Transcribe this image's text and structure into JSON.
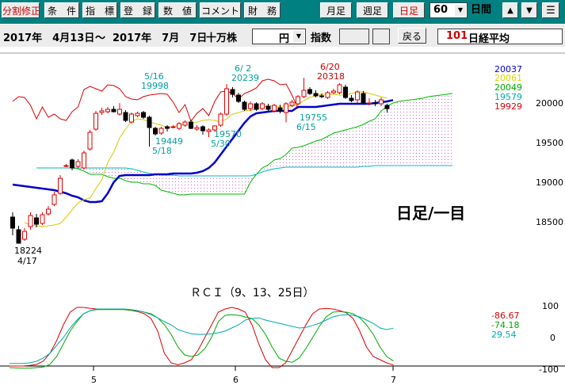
{
  "toolbar": {
    "buttons": [
      "分割修正",
      "条　件",
      "指　標",
      "登　録",
      "数　値",
      "コメント",
      "財　務"
    ],
    "period_buttons": [
      "月足",
      "週足",
      "日足"
    ],
    "count_value": "60",
    "count_unit": "日間",
    "nav_icons": [
      "up-arrow-icon",
      "down-arrow-icon",
      "menu-icon"
    ],
    "accent_color": "#008080"
  },
  "range_bar": {
    "start_date": "2017年　4月13日",
    "tilde": "～",
    "end_date": "2017年　7月　7日",
    "unit_label": "十万株",
    "currency_value": "円",
    "index_label": "指数",
    "back_button": "戻る",
    "code": "101",
    "name": "日経平均"
  },
  "chart_data": [
    {
      "type": "candlestick",
      "label": "日足/一目",
      "y_ticks": [
        18500,
        19000,
        19500,
        20000
      ],
      "ylim": [
        18200,
        20700
      ],
      "x_ticks": [
        "5",
        "6",
        "7"
      ],
      "legend_values": [
        {
          "value": "20037",
          "color": "#0000cc"
        },
        {
          "value": "20061",
          "color": "#d8d800"
        },
        {
          "value": "20049",
          "color": "#00aa00"
        },
        {
          "value": "19579",
          "color": "#00aaaa"
        },
        {
          "value": "19929",
          "color": "#dd0000"
        }
      ],
      "annotations": [
        {
          "text": "18224",
          "date": "4/17",
          "color": "#000000"
        },
        {
          "text": "19998",
          "date": "5/16",
          "color": "#00a0a0"
        },
        {
          "text": "19449",
          "date": "5/18",
          "color": "#00a0a0"
        },
        {
          "text": "19570",
          "date": "5/30",
          "color": "#00a0a0"
        },
        {
          "text": "20239",
          "date": "6/ 2",
          "color": "#00a0a0"
        },
        {
          "text": "19755",
          "date": "6/15",
          "color": "#00a0a0"
        },
        {
          "text": "20318",
          "date": "6/20",
          "color": "#cc0000"
        }
      ],
      "candles": [
        [
          18560,
          18420,
          18620,
          18330
        ],
        [
          18400,
          18230,
          18450,
          18224
        ],
        [
          18280,
          18380,
          18420,
          18260
        ],
        [
          18440,
          18580,
          18620,
          18400
        ],
        [
          18550,
          18470,
          18600,
          18430
        ],
        [
          18480,
          18590,
          18620,
          18460
        ],
        [
          18600,
          18660,
          18700,
          18580
        ],
        [
          18720,
          18840,
          18880,
          18700
        ],
        [
          18860,
          19050,
          19090,
          18840
        ],
        [
          19210,
          19210,
          19230,
          19190
        ],
        [
          19280,
          19180,
          19300,
          19150
        ],
        [
          19200,
          19260,
          19290,
          19180
        ],
        [
          19180,
          19370,
          19400,
          19160
        ],
        [
          19420,
          19630,
          19660,
          19400
        ],
        [
          19670,
          19870,
          19900,
          19650
        ],
        [
          19880,
          19900,
          19940,
          19850
        ],
        [
          19890,
          19920,
          19950,
          19870
        ],
        [
          19920,
          19890,
          19960,
          19880
        ],
        [
          19860,
          19920,
          19998,
          19840
        ],
        [
          19880,
          19780,
          19910,
          19760
        ],
        [
          19760,
          19860,
          19880,
          19740
        ],
        [
          19840,
          19870,
          19890,
          19820
        ],
        [
          19880,
          19820,
          19900,
          19800
        ],
        [
          19820,
          19690,
          19840,
          19449
        ],
        [
          19680,
          19610,
          19700,
          19590
        ],
        [
          19620,
          19680,
          19700,
          19600
        ],
        [
          19700,
          19680,
          19720,
          19640
        ],
        [
          19690,
          19700,
          19720,
          19680
        ],
        [
          19680,
          19740,
          19760,
          19660
        ],
        [
          19720,
          19760,
          19780,
          19700
        ],
        [
          19760,
          19680,
          19790,
          19670
        ],
        [
          19670,
          19690,
          19720,
          19650
        ],
        [
          19700,
          19650,
          19720,
          19600
        ],
        [
          19640,
          19660,
          19680,
          19570
        ],
        [
          19660,
          19710,
          19720,
          19640
        ],
        [
          19720,
          19860,
          19880,
          19700
        ],
        [
          19860,
          20180,
          20239,
          19840
        ],
        [
          20170,
          20110,
          20200,
          20070
        ],
        [
          20100,
          20020,
          20130,
          20000
        ],
        [
          20010,
          19920,
          20030,
          19900
        ],
        [
          19930,
          19990,
          20020,
          19900
        ],
        [
          19990,
          19920,
          20010,
          19900
        ],
        [
          19930,
          19990,
          20010,
          19910
        ],
        [
          19960,
          19920,
          19990,
          19900
        ],
        [
          19900,
          19970,
          19990,
          19880
        ],
        [
          19940,
          19900,
          19980,
          19870
        ],
        [
          19880,
          19990,
          20010,
          19755
        ],
        [
          19970,
          20010,
          20040,
          19950
        ],
        [
          19990,
          20080,
          20100,
          19970
        ],
        [
          20080,
          20160,
          20318,
          20060
        ],
        [
          20170,
          20120,
          20200,
          20100
        ],
        [
          20120,
          20090,
          20160,
          20070
        ],
        [
          20090,
          20080,
          20120,
          20060
        ],
        [
          20070,
          20130,
          20150,
          20050
        ],
        [
          20130,
          20150,
          20180,
          20110
        ],
        [
          20130,
          20230,
          20250,
          20110
        ],
        [
          20200,
          20070,
          20230,
          20050
        ],
        [
          20060,
          20030,
          20100,
          20010
        ],
        [
          20040,
          20140,
          20160,
          20000
        ],
        [
          20120,
          20000,
          20150,
          19980
        ],
        [
          20000,
          20000,
          20060,
          19970
        ],
        [
          20000,
          19990,
          20040,
          19960
        ],
        [
          19990,
          20040,
          20070,
          19960
        ],
        [
          19970,
          19929,
          19990,
          19880
        ]
      ],
      "kijun": [
        18970,
        18960,
        18950,
        18940,
        18930,
        18920,
        18910,
        18900,
        18880,
        18860,
        18830,
        18810,
        18770,
        18750,
        18750,
        18760,
        18860,
        19000,
        19080,
        19090,
        19090,
        19090,
        19090,
        19090,
        19100,
        19100,
        19100,
        19110,
        19110,
        19110,
        19110,
        19120,
        19140,
        19180,
        19250,
        19350,
        19450,
        19550,
        19650,
        19750,
        19830,
        19870,
        19880,
        19890,
        19900,
        19900,
        19900,
        19900,
        19950,
        19950,
        19950,
        19950,
        19960,
        19970,
        19980,
        19990,
        19990,
        19990,
        19990,
        19990,
        19990,
        20000,
        20010,
        20020,
        20037
      ],
      "tenkan": [
        18490,
        18460,
        18450,
        18440,
        18450,
        18460,
        18480,
        18560,
        18650,
        18740,
        18780,
        18800,
        18920,
        19030,
        19250,
        19380,
        19560,
        19670,
        19770,
        19800,
        19790,
        19760,
        19740,
        19720,
        19690,
        19700,
        19720,
        19730,
        19740,
        19760,
        19780,
        19790,
        19780,
        19760,
        19800,
        19860,
        19880,
        19900,
        19910,
        19920,
        19950,
        19960,
        19960,
        19960,
        19960,
        19960,
        19980,
        20030,
        20070,
        20090,
        20110,
        20110,
        20110,
        20100,
        20100,
        20120,
        20140,
        20140,
        20120,
        20100,
        20080,
        20061
      ],
      "chikou": [
        20020,
        20080,
        20070,
        19970,
        19800,
        19950,
        19820,
        19860,
        19800,
        19780,
        19890,
        19950,
        20170,
        20210,
        20180,
        20150,
        20230,
        20220,
        20180,
        20080,
        20050,
        20040,
        20080,
        20100,
        20110,
        20120,
        20110,
        20010,
        19880,
        19980,
        19770,
        19870,
        19930,
        19840,
        20020,
        20140,
        20150,
        20120,
        20050,
        20120,
        20150,
        20190,
        20280,
        20300,
        20280,
        20230,
        20240,
        20100,
        19929
      ],
      "senkou_a_start": 4,
      "senkou_a": [
        19180,
        19180,
        19180,
        19180,
        19180,
        19180,
        19180,
        19170,
        19140,
        19100,
        19100,
        19100,
        19070,
        19050,
        19050,
        19020,
        19000,
        19000,
        18980,
        18980,
        18960,
        18900,
        18880,
        18860,
        18840,
        18840,
        18850,
        18850,
        18850,
        18850,
        18850,
        18850,
        18850,
        18850,
        18850,
        18850,
        19000,
        19100,
        19180,
        19220,
        19280,
        19300,
        19350,
        19430,
        19440,
        19460,
        19490,
        19520,
        19540,
        19580,
        19620,
        19640,
        19660,
        19680,
        19700,
        19730,
        19770,
        19800,
        19900,
        19960,
        20000,
        20020,
        20030,
        20040,
        20050,
        20060,
        20080,
        20090,
        20100,
        20110,
        20120
      ],
      "senkou_b_start": 4,
      "senkou_b": [
        19180,
        19180,
        19180,
        19180,
        19180,
        19180,
        19180,
        19180,
        19180,
        19180,
        19180,
        19180,
        19180,
        19180,
        19180,
        19180,
        19170,
        19150,
        19130,
        19110,
        19100,
        19090,
        19090,
        19090,
        19080,
        19080,
        19080,
        19080,
        19080,
        19080,
        19080,
        19080,
        19080,
        19080,
        19080,
        19080,
        19080,
        19100,
        19130,
        19150,
        19170,
        19180,
        19190,
        19190,
        19190,
        19190,
        19190,
        19190,
        19190,
        19190,
        19190,
        19190,
        19190,
        19190,
        19190,
        19200,
        19200,
        19210,
        19210,
        19210,
        19210,
        19210,
        19210,
        19210,
        19210,
        19210,
        19210,
        19210,
        19210,
        19210,
        19210
      ]
    },
    {
      "type": "line",
      "title": "ＲＣＩ（9、13、25日）",
      "ylim": [
        -100,
        100
      ],
      "y_ticks": [
        100,
        0,
        -100
      ],
      "series": [
        {
          "name": "9",
          "color": "#dd0000",
          "final": "-86.67",
          "values": [
            -90,
            -90,
            -90,
            -88,
            -85,
            -75,
            -50,
            -10,
            40,
            80,
            95,
            95,
            92,
            90,
            90,
            90,
            90,
            88,
            86,
            82,
            75,
            60,
            20,
            -50,
            -80,
            -86,
            -80,
            -70,
            -40,
            0,
            40,
            80,
            90,
            95,
            90,
            80,
            40,
            -20,
            -70,
            -95,
            -95,
            -80,
            -40,
            0,
            40,
            75,
            90,
            92,
            90,
            85,
            78,
            60,
            20,
            -30,
            -60,
            -70,
            -80,
            -86.67
          ]
        },
        {
          "name": "13",
          "color": "#00aa00",
          "final": "-74.18",
          "values": [
            -95,
            -96,
            -97,
            -97,
            -95,
            -93,
            -85,
            -60,
            -20,
            20,
            50,
            75,
            85,
            88,
            88,
            88,
            88,
            88,
            86,
            85,
            80,
            75,
            62,
            40,
            10,
            -30,
            -55,
            -60,
            -55,
            -35,
            0,
            50,
            70,
            72,
            70,
            65,
            60,
            40,
            10,
            -30,
            -65,
            -75,
            -78,
            -65,
            -35,
            0,
            35,
            65,
            80,
            82,
            80,
            75,
            62,
            40,
            10,
            -30,
            -60,
            -74.18
          ]
        },
        {
          "name": "25",
          "color": "#00aaaa",
          "final": "29.54",
          "values": [
            -82,
            -82,
            -82,
            -80,
            -75,
            -65,
            -50,
            -25,
            0,
            30,
            55,
            75,
            85,
            90,
            90,
            90,
            90,
            90,
            88,
            85,
            80,
            72,
            62,
            50,
            40,
            25,
            18,
            12,
            10,
            10,
            12,
            15,
            20,
            30,
            40,
            55,
            60,
            62,
            55,
            50,
            45,
            40,
            35,
            30,
            32,
            38,
            45,
            55,
            65,
            70,
            72,
            70,
            65,
            55,
            45,
            30,
            25,
            29.54
          ]
        }
      ]
    }
  ]
}
